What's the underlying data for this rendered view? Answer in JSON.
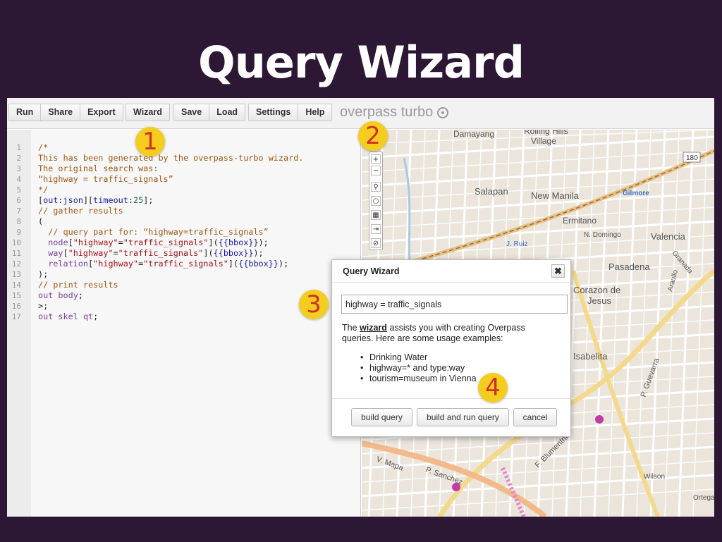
{
  "slide": {
    "title": "Query Wizard"
  },
  "toolbar": {
    "groups": [
      [
        "Run",
        "Share",
        "Export"
      ],
      [
        "Wizard"
      ],
      [
        "Save",
        "Load"
      ],
      [
        "Settings",
        "Help"
      ]
    ],
    "brand": "overpass turbo"
  },
  "editor": {
    "lines": [
      {
        "n": "1",
        "parts": [
          [
            "c-com",
            "/*"
          ]
        ]
      },
      {
        "n": "2",
        "parts": [
          [
            "c-com",
            "This has been generated by the overpass-turbo wizard."
          ]
        ]
      },
      {
        "n": "3",
        "parts": [
          [
            "c-com",
            "The original search was:"
          ]
        ]
      },
      {
        "n": "4",
        "parts": [
          [
            "c-com",
            "“highway = traffic_signals”"
          ]
        ]
      },
      {
        "n": "5",
        "parts": [
          [
            "c-com",
            "*/"
          ]
        ]
      },
      {
        "n": "6",
        "parts": [
          [
            "c-plain",
            "["
          ],
          [
            "c-def",
            "out"
          ],
          [
            "c-plain",
            ":"
          ],
          [
            "c-def",
            "json"
          ],
          [
            "c-plain",
            "]["
          ],
          [
            "c-def",
            "timeout"
          ],
          [
            "c-plain",
            ":"
          ],
          [
            "c-num",
            "25"
          ],
          [
            "c-plain",
            "];"
          ]
        ]
      },
      {
        "n": "7",
        "parts": [
          [
            "c-com",
            "// gather results"
          ]
        ]
      },
      {
        "n": "8",
        "parts": [
          [
            "c-plain",
            "("
          ]
        ]
      },
      {
        "n": "9",
        "parts": [
          [
            "c-com",
            "  // query part for: “highway=traffic_signals”"
          ]
        ]
      },
      {
        "n": "10",
        "parts": [
          [
            "c-kw",
            "  node"
          ],
          [
            "c-plain",
            "["
          ],
          [
            "c-str",
            "\"highway\""
          ],
          [
            "c-plain",
            "="
          ],
          [
            "c-str",
            "\"traffic_signals\""
          ],
          [
            "c-plain",
            "]("
          ],
          [
            "c-def",
            "{{bbox}}"
          ],
          [
            "c-plain",
            ");"
          ]
        ]
      },
      {
        "n": "11",
        "parts": [
          [
            "c-kw",
            "  way"
          ],
          [
            "c-plain",
            "["
          ],
          [
            "c-str",
            "\"highway\""
          ],
          [
            "c-plain",
            "="
          ],
          [
            "c-str",
            "\"traffic_signals\""
          ],
          [
            "c-plain",
            "]("
          ],
          [
            "c-def",
            "{{bbox}}"
          ],
          [
            "c-plain",
            ");"
          ]
        ]
      },
      {
        "n": "12",
        "parts": [
          [
            "c-kw",
            "  relation"
          ],
          [
            "c-plain",
            "["
          ],
          [
            "c-str",
            "\"highway\""
          ],
          [
            "c-plain",
            "="
          ],
          [
            "c-str",
            "\"traffic_signals\""
          ],
          [
            "c-plain",
            "]("
          ],
          [
            "c-def",
            "{{bbox}}"
          ],
          [
            "c-plain",
            ");"
          ]
        ]
      },
      {
        "n": "13",
        "parts": [
          [
            "c-plain",
            ");"
          ]
        ]
      },
      {
        "n": "14",
        "parts": [
          [
            "c-com",
            "// print results"
          ]
        ]
      },
      {
        "n": "15",
        "parts": [
          [
            "c-kw",
            "out"
          ],
          [
            "c-plain",
            " "
          ],
          [
            "c-kw",
            "body"
          ],
          [
            "c-plain",
            ";"
          ]
        ]
      },
      {
        "n": "16",
        "parts": [
          [
            "c-plain",
            ">;"
          ]
        ]
      },
      {
        "n": "17",
        "parts": [
          [
            "c-kw",
            "out"
          ],
          [
            "c-plain",
            " "
          ],
          [
            "c-kw",
            "skel"
          ],
          [
            "c-plain",
            " "
          ],
          [
            "c-kw",
            "qt"
          ],
          [
            "c-plain",
            ";"
          ]
        ]
      }
    ]
  },
  "map": {
    "zoom_in": "+",
    "zoom_out": "−",
    "labels": [
      "Damayang",
      "Rolling Hills",
      "Village",
      "Salapan",
      "New Manila",
      "Gilmore",
      "Ermitano",
      "N. Domingo",
      "Valencia",
      "J. Ruiz",
      "Pasadena",
      "Corazon de",
      "Jesus",
      "Isabelita",
      "P. Guevarra",
      "P. Sanchez",
      "V. Mapa",
      "F. Blumentritt",
      "Granada",
      "Wilson",
      "Ortega",
      "Araullo",
      "180"
    ]
  },
  "dialog": {
    "title": "Query Wizard",
    "close": "✖",
    "input_value": "highway = traffic_signals",
    "help_prefix": "The ",
    "help_link": "wizard",
    "help_suffix": " assists you with creating Overpass queries. Here are some usage examples:",
    "examples": [
      "Drinking Water",
      "highway=* and type:way",
      "tourism=museum in Vienna"
    ],
    "buttons": {
      "build": "build query",
      "build_run": "build and run query",
      "cancel": "cancel"
    }
  },
  "callouts": [
    "1",
    "2",
    "3",
    "4"
  ],
  "colors": {
    "background": "#2c1835",
    "callout_fill": "#f5cd1f",
    "callout_text": "#d0302a"
  }
}
